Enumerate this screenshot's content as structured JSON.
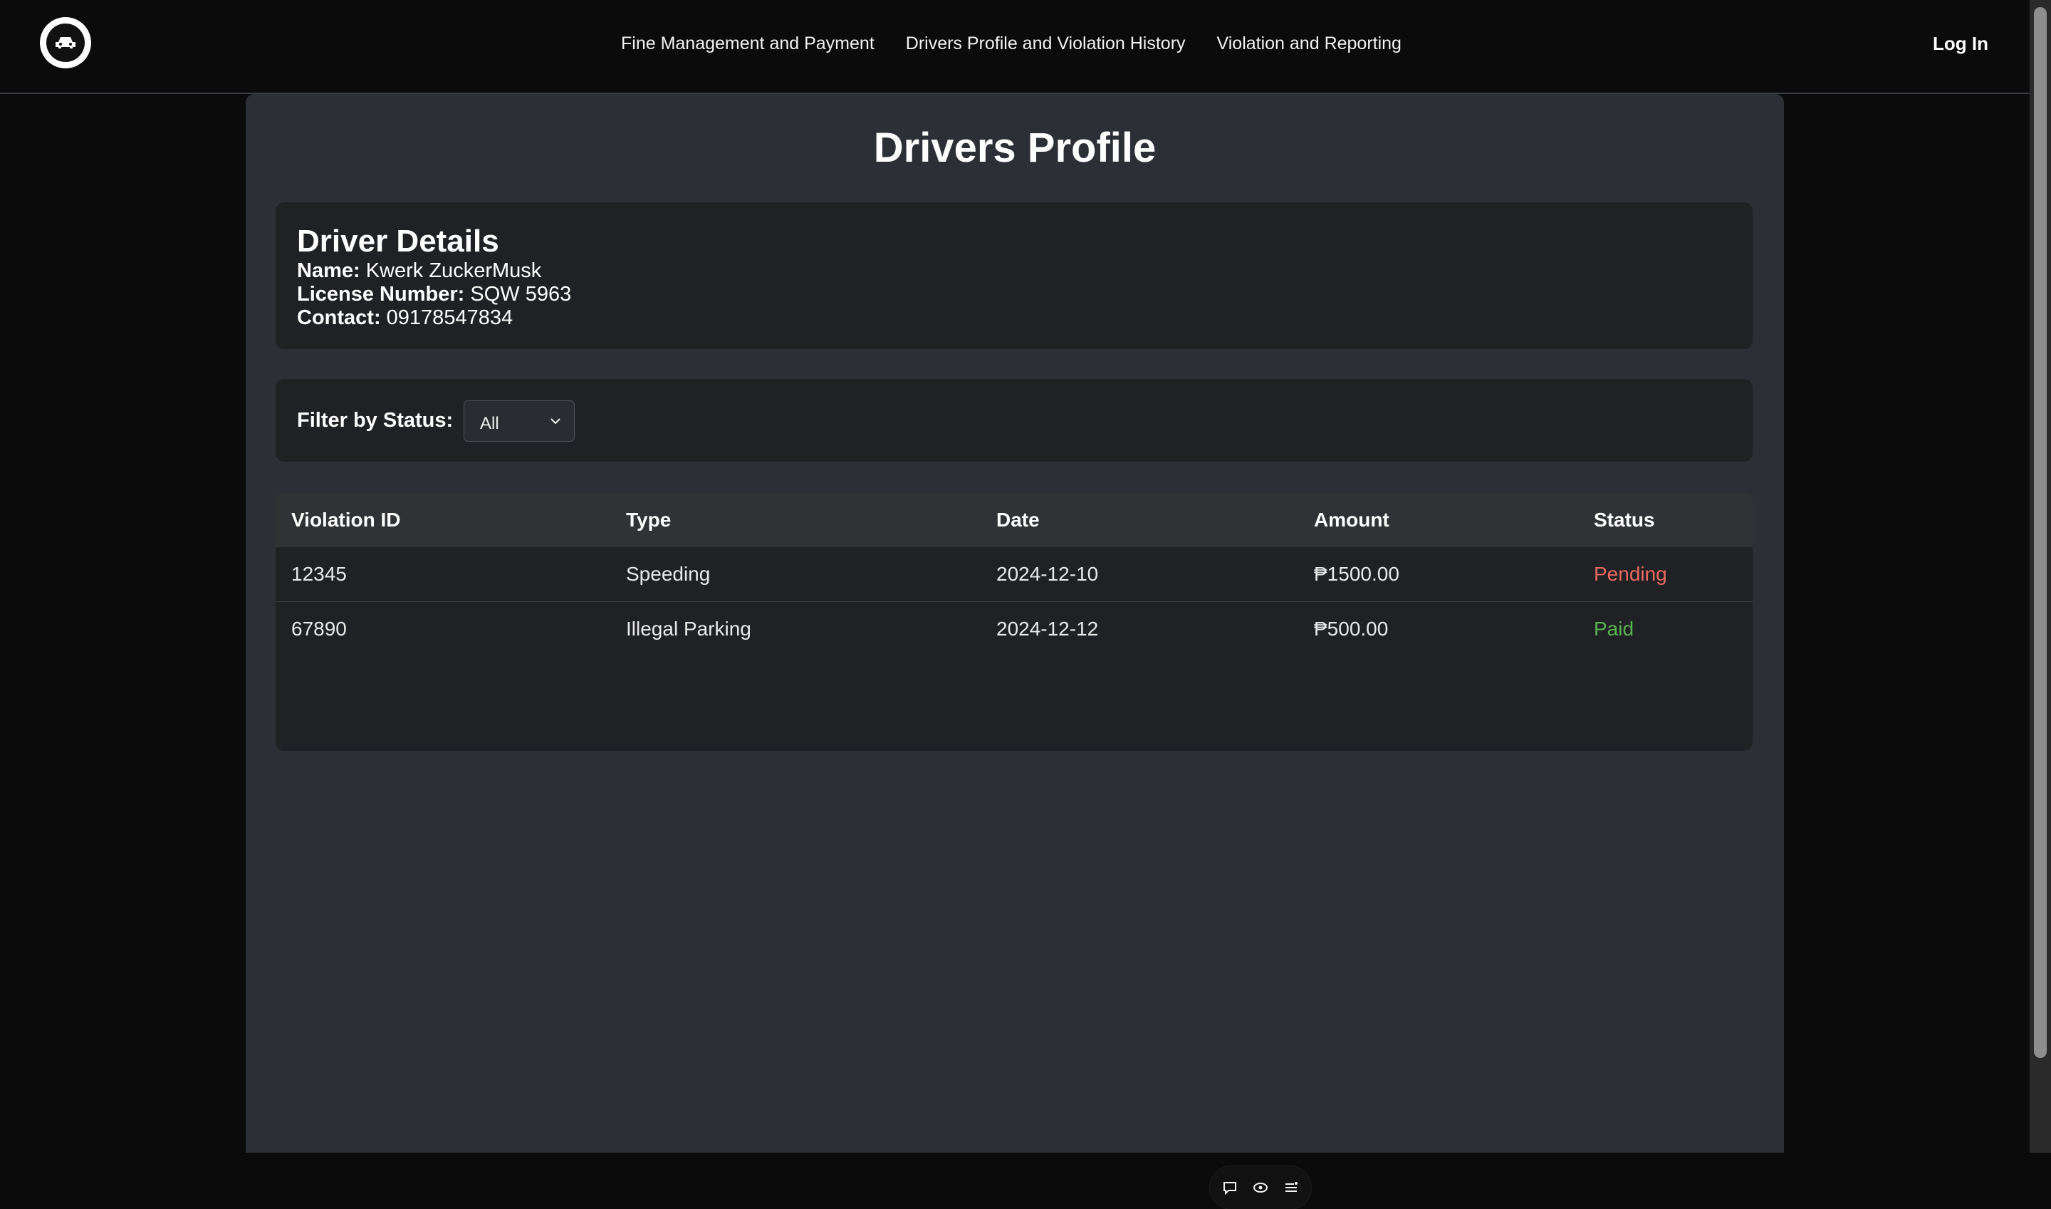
{
  "header": {
    "logo_icon": "traffic-enforcer-logo",
    "nav_links": [
      "Fine Management and Payment",
      "Drivers Profile and Violation History",
      "Violation and Reporting"
    ],
    "login_label": "Log In"
  },
  "main": {
    "title": "Drivers Profile",
    "driver_details": {
      "heading": "Driver Details",
      "name_label": "Name:",
      "name": "Kwerk ZuckerMusk",
      "license_label": "License Number:",
      "license": "SQW 5963",
      "contact_label": "Contact:",
      "contact": "09178547834"
    },
    "filter": {
      "label": "Filter by Status:",
      "selected": "All"
    },
    "table": {
      "headers": [
        "Violation ID",
        "Type",
        "Date",
        "Amount",
        "Status"
      ],
      "rows": [
        {
          "id": "12345",
          "type": "Speeding",
          "date": "2024-12-10",
          "amount": "₱1500.00",
          "status": "Pending"
        },
        {
          "id": "67890",
          "type": "Illegal Parking",
          "date": "2024-12-12",
          "amount": "₱500.00",
          "status": "Paid"
        }
      ]
    }
  },
  "floating_toolbar": {
    "icons": [
      "chat-icon",
      "eye-icon",
      "settings-list-icon"
    ]
  },
  "colors": {
    "background": "#0b0b0b",
    "panel": "#2c2f36",
    "card": "#202124",
    "pending": "#ea6a61",
    "paid": "#58b453"
  }
}
